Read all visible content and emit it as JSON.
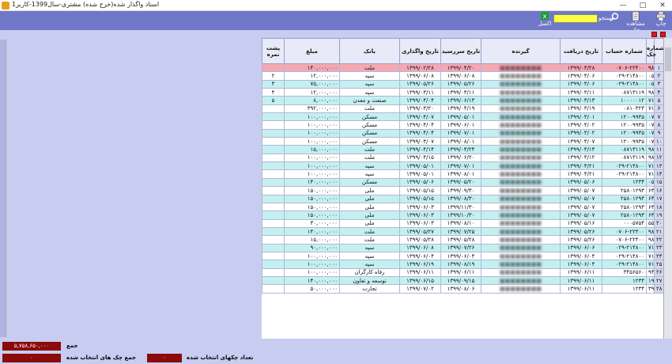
{
  "window": {
    "title": "اسناد واگذار شده(خرج شده) مشتری-سال1399-کاربر1",
    "minimize": "—",
    "maximize": "□",
    "close": "✕"
  },
  "toolbar": {
    "print_label": "چاپ",
    "view_label": "مشاهده چک",
    "search_label": "جستجو",
    "search_value": "",
    "excel_label": "اکسل"
  },
  "columns": [
    "شماره چک",
    "شماره حساب",
    "گیرنده",
    "تاریخ دریافت",
    "تاریخ سررسید",
    "تاریخ واگذاری",
    "بانک",
    "مبلغ",
    "پشت نمره"
  ],
  "rows": [
    {
      "chk": "۹۸۷۳۶۸",
      "acc": "۰۷۰۶-۲۲۴۰۰",
      "recv": "۱۳۹۹/۰۳/۲۸",
      "due": "۱۳۹۹/۰۴/۲۰",
      "assign": "۱۳۹۹/۰۲/۲۸",
      "bank": "ملت",
      "amt": "۱۴۰,۰۰۰,۰۰۰",
      "back": ""
    },
    {
      "chk": "۰۵۳۵۲۱",
      "acc": "۰۲۹-۲۱۴۸۰۰",
      "recv": "۱۳۹۹/۰۳/۰۶",
      "due": "۱۳۹۹/۰۶/۰۸",
      "assign": "۱۳۹۹/۰۶/۰۸",
      "bank": "سپه",
      "amt": "۱۲,۰۰۰,۰۰۰",
      "back": "۲"
    },
    {
      "chk": "۰۵۳۵۲۰",
      "acc": "۰۲۹-۲۱۴۸۰۰",
      "recv": "۱۳۹۹/۰۳/۰۶",
      "due": "۱۳۹۹/۰۵/۲۶",
      "assign": "۱۳۹۹/۰۵/۲۶",
      "bank": "سپه",
      "amt": "۷۵,۰۰۰,۰۰۰",
      "back": "۳"
    },
    {
      "chk": "۹۸۷۳۶۹",
      "acc": "۰۸۷۱۳۱۱۹",
      "recv": "۱۳۹۹/۰۳/۱۱",
      "due": "۱۳۹۹/۰۳/۱۱",
      "assign": "۱۳۹۹/۰۳/۱۱",
      "bank": "سپه",
      "amt": "۱۲,۰۰۰,۰۰۰",
      "back": "۴"
    },
    {
      "chk": "۷۱۴۴۲۶",
      "acc": "۱۰۰۰۰۰۱۲",
      "recv": "۱۳۹۹/۰۳/۱۳",
      "due": "۱۳۹۹/۰۶/۱۳",
      "assign": "۱۳۹۹/۰۴/۰۴",
      "bank": "صنعت و معدن",
      "amt": "۸,۰۰۰,۰۰۰",
      "back": "۵"
    },
    {
      "chk": "۷۱۴۴۱۲/۴۸",
      "acc": "۰۸۱۰۳۲۳",
      "recv": "۱۳۹۹/۰۳/۱۹",
      "due": "۱۳۹۹/۰۴/۱۹",
      "assign": "۱۳۹۹/۰۳/۲۰",
      "bank": "ملت",
      "amt": "۳۹۲,۰۰۰,۰۰۰",
      "back": ""
    },
    {
      "chk": "۰۷۱۰۲۸",
      "acc": "۱۲۰۰۹۹۳۵",
      "recv": "۱۳۹۹/۰۳/۰۱",
      "due": "۱۳۹۹/۰۵/۰۱",
      "assign": "۱۳۹۹/۰۴/۰۷",
      "bank": "مسکن",
      "amt": "۱۰۰,۰۰۰,۰۰۰",
      "back": ""
    },
    {
      "chk": "۰۷۱۰۲۹",
      "acc": "۱۲۰۰۹۹۳۵",
      "recv": "۱۳۹۹/۰۴/۰۲",
      "due": "۱۳۹۹/۰۶/۰۱",
      "assign": "۱۳۹۹/۰۴/۰۴",
      "bank": "مسکن",
      "amt": "۱۰۰,۰۰۰,۰۰۰",
      "back": ""
    },
    {
      "chk": "۰۷۱۰۳۰",
      "acc": "۱۲۰۰۹۹۳۵",
      "recv": "۱۳۹۹/۰۳/۰۲",
      "due": "۱۳۹۹/۰۷/۰۱",
      "assign": "۱۳۹۹/۰۴/۰۴",
      "bank": "مسکن",
      "amt": "۱۰۰,۰۰۰,۰۰۰",
      "back": ""
    },
    {
      "chk": "۰۷۱۰۳۱",
      "acc": "۱۲۰۰۹۹۳۵",
      "recv": "۱۳۹۹/۰۴/۰۷",
      "due": "۱۳۹۹/۰۸/۰۱",
      "assign": "۱۳۹۹/۰۴/۰۷",
      "bank": "مسکن",
      "amt": "۱۰۰,۰۰۰,۰۰۰",
      "back": ""
    },
    {
      "chk": "۹۸۷۳۷۱",
      "acc": "۰۸۷۱۳۱۱۹",
      "recv": "۱۳۹۹/۰۴/۱۴",
      "due": "۱۳۹۹/۰۴/۲۴",
      "assign": "۱۳۹۹/۰۴/۱۴",
      "bank": "ملت",
      "amt": "۱۵,۰۰۰,۰۰۰",
      "back": ""
    },
    {
      "chk": "۹۸۷۷۷۷/۵۸",
      "acc": "۰۸۷۱۳۱۱۹",
      "recv": "۱۳۹۹/۰۴/۱۲",
      "due": "۱۳۹۹/۰۶/۲۰",
      "assign": "۱۳۹۹/۰۴/۱۵",
      "bank": "ملت",
      "amt": "۱۰۰,۰۰۰,۰۰۰",
      "back": ""
    },
    {
      "chk": "۷۱۴۲۰۶",
      "acc": "۰۲۹-۲۱۴۸۰۰",
      "recv": "۱۳۹۹/۰۴/۲۱",
      "due": "۱۳۹۹/۰۷/۰۱",
      "assign": "۱۳۹۹/۰۵/۰۱",
      "bank": "سپه",
      "amt": "۱۰۰,۰۰۰,۰۰۰",
      "back": ""
    },
    {
      "chk": "۷۱۴۲۰۹",
      "acc": "۰۲۹-۲۱۴۸۰۰",
      "recv": "۱۳۹۹/۰۴/۲۱",
      "due": "۱۳۹۹/۰۸/۰۱",
      "assign": "۱۳۹۹/۰۵/۰۱",
      "bank": "سپه",
      "amt": "۱۰۰,۰۰۰,۰۰۰",
      "back": ""
    },
    {
      "chk": "۰۵۴۵۰",
      "acc": "۱۲۳۴",
      "recv": "۱۳۹۹/۰۵/۰۶",
      "due": "۱۳۹۹/۰۵/۲۰",
      "assign": "۱۳۹۹/۰۵/۰۶",
      "bank": "مسکن",
      "amt": "۱۴۰,۰۰۰,۰۰۰",
      "back": ""
    },
    {
      "chk": "۶۴۵۱۳۱",
      "acc": "۲۵۸۰۱۲۹۳",
      "recv": "۱۳۹۹/۰۵/۰۷",
      "due": "۱۳۹۹/۰۹/۳۰",
      "assign": "۱۳۹۹/۰۵/۱۵",
      "bank": "ملی",
      "amt": "۱۵۰,۰۰۰,۰۰۰",
      "back": ""
    },
    {
      "chk": "۶۴۵۱۳۰",
      "acc": "۲۵۸۰۱۲۹۳",
      "recv": "۱۳۹۹/۰۵/۰۷",
      "due": "۱۳۹۹/۰۸/۳۰",
      "assign": "۱۳۹۹/۰۵/۱۵",
      "bank": "ملی",
      "amt": "۱۵۰,۰۰۰,۰۰۰",
      "back": ""
    },
    {
      "chk": "۶۴۵۱۲۲",
      "acc": "۲۵۸۰۱۲۹۳",
      "recv": "۱۳۹۹/۰۵/۰۷",
      "due": "۱۳۹۹/۱۱/۳۰",
      "assign": "۱۳۹۹/۰۶/۰۳",
      "bank": "ملی",
      "amt": "۱۵۰,۰۰۰,۰۰۰",
      "back": ""
    },
    {
      "chk": "۶۴۵۱۲۵",
      "acc": "۲۵۸۰۱۲۹۳",
      "recv": "۱۳۹۹/۰۵/۰۷",
      "due": "۱۳۹۹/۱۰/۳۰",
      "assign": "۱۳۹۹/۰۶/۰۳",
      "bank": "ملی",
      "amt": "۱۵۰,۰۰۰,۰۰۰",
      "back": ""
    },
    {
      "chk": "۵۵۹۱۵۷",
      "acc": "۰۰۰۵۷۵۴",
      "recv": "۱۳۹۹/۰۵/۱۶",
      "due": "۱۳۹۹/۰۸/۱۰",
      "assign": "۱۳۹۹/۰۶/۰۳",
      "bank": "ملی",
      "amt": "۳۰,۰۰۰,۰۰۰",
      "back": ""
    },
    {
      "chk": "۹۸۷۹۸۰/۲۰",
      "acc": "۰۷۰۶-۲۲۴۰۰",
      "recv": "۱۳۹۹/۰۵/۲۶",
      "due": "۱۳۹۹/۰۷/۲۵",
      "assign": "۱۳۹۹/۰۵/۲۷",
      "bank": "ملت",
      "amt": "۱۴۰,۰۰۰,۰۰۰",
      "back": ""
    },
    {
      "chk": "۹۸۷۳۹۶",
      "acc": "۰۷۰۶-۲۲۴۰۰",
      "recv": "۱۳۹۹/۰۵/۲۶",
      "due": "۱۳۹۹/۰۵/۲۸",
      "assign": "۱۳۹۹/۰۵/۲۸",
      "bank": "ملت",
      "amt": "۱۵,۰۰۰,۰۰۰",
      "back": ""
    },
    {
      "chk": "۷۱۴۴۲۱",
      "acc": "۰۲۹-۲۱۴۸۰۰",
      "recv": "۱۳۹۹/۰۶/۰۶",
      "due": "۱۳۹۹/۰۷/۲۶",
      "assign": "۱۳۹۹/۰۶/۰۸",
      "bank": "سپه",
      "amt": "۹۰,۰۰۰,۰۰۰",
      "back": ""
    },
    {
      "chk": "۷۱۴۴۲۳",
      "acc": "۰۲۹-۲۱۴۸۰۰",
      "recv": "۱۳۹۹/۰۶/۰۴",
      "due": "۱۳۹۹/۰۶/۰۴",
      "assign": "۱۳۹۹/۰۶/۰۴",
      "bank": "سپه",
      "amt": "۱۰۰,۰۰۰,۰۰۰",
      "back": ""
    },
    {
      "chk": "۷۱۴۴۲۲",
      "acc": "۰۲۹-۲۱۴۸۰۰",
      "recv": "۱۳۹۹/۰۶/۰۴",
      "due": "۱۳۹۹/۰۸/۱۹",
      "assign": "۱۳۹۹/۰۶/۱۹",
      "bank": "سپه",
      "amt": "۱۰۰,۰۰۰,۰۰۰",
      "back": ""
    },
    {
      "chk": "۹۴۳۶۹۰",
      "acc": "۳۴۵۶۵۶۰",
      "recv": "۱۳۹۹/۰۶/۱۱",
      "due": "۱۳۹۹/۰۶/۱۱",
      "assign": "۱۳۹۹/۰۶/۱۱",
      "bank": "رفاه کارگران",
      "amt": "۱۰۰,۰۰۰,۰۰۰",
      "back": ""
    },
    {
      "chk": "۱۹۲۹۸۵",
      "acc": "۱۲۳۴",
      "recv": "۱۳۹۹/۰۶/۱۱",
      "due": "۱۳۹۹/۰۹/۱۵",
      "assign": "۱۳۹۹/۰۶/۱۵",
      "bank": "توسعه و تعاون",
      "amt": "۱۴۰,۰۰۰,۰۰۰",
      "back": ""
    },
    {
      "chk": "۳۹۱۶۵۴",
      "acc": "۱۲۳۴",
      "recv": "۱۳۹۹/۰۶/۱۱",
      "due": "۱۳۹۹/۰۸/۰۶",
      "assign": "۱۳۹۹/۰۷/۰۲",
      "bank": "تجارت",
      "amt": "۵۰,۰۰۰,۰۰۰",
      "back": ""
    }
  ],
  "footer": {
    "total_label": "جمع",
    "total_value": "۵,۷۵۸,۶۵۰,۰۰۰",
    "selected_total_label": "جمع چک های انتخاب شده",
    "selected_total_value": "۰",
    "selected_count_label": "تعداد چکهای انتخاب شده",
    "selected_count_value": "۰"
  }
}
